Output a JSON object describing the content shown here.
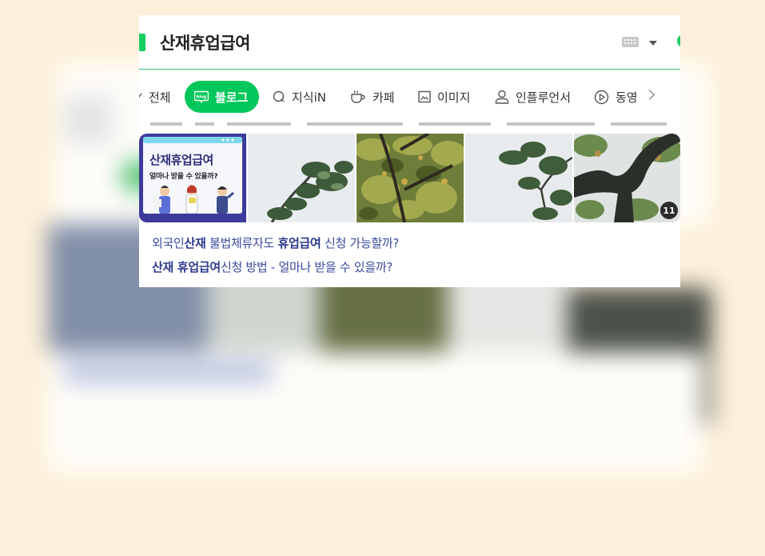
{
  "search": {
    "query": "산재휴업급여"
  },
  "tabs": [
    {
      "label": "전체",
      "icon": "close-icon-partial"
    },
    {
      "label": "블로그",
      "icon": "blog-icon",
      "active": true
    },
    {
      "label": "지식iN",
      "icon": "q-icon"
    },
    {
      "label": "카페",
      "icon": "cup-icon"
    },
    {
      "label": "이미지",
      "icon": "image-icon"
    },
    {
      "label": "인플루언서",
      "icon": "person-icon"
    },
    {
      "label": "동영",
      "icon": "play-icon"
    }
  ],
  "thumbnail": {
    "title": "산재휴업급여",
    "subtitle": "얼마나 받을 수 있을까?",
    "image_count": "11"
  },
  "results": [
    {
      "parts": [
        "외국인",
        "산재",
        " 불법체류자도 ",
        "휴업급여",
        " 신청 가능할까?"
      ]
    },
    {
      "parts": [
        "산재 휴업급여",
        "신청 방법 - 얼마나 받을 수 있을까?"
      ]
    }
  ],
  "colors": {
    "accent": "#03c75a",
    "link": "#3a4a9c",
    "background": "#fdf0da"
  }
}
